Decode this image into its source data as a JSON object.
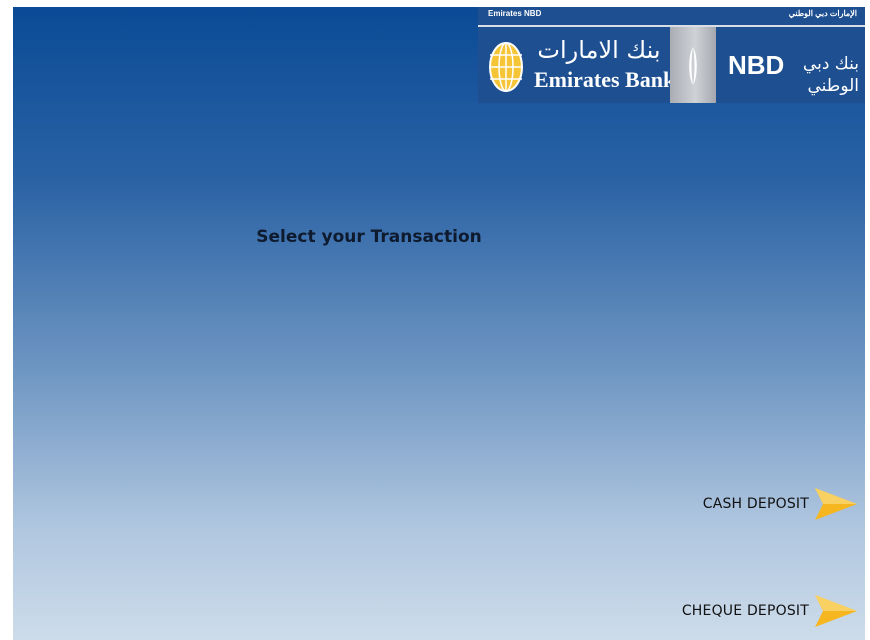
{
  "logo": {
    "top_left_text": "Emirates NBD",
    "top_right_text": "الإمارات دبي الوطني",
    "emirates_bank_arabic": "بنك الامارات",
    "emirates_bank_english": "Emirates Bank",
    "nbd_text": "NBD",
    "nbd_arabic": "بنك دبي الوطني"
  },
  "screen": {
    "title": "Select your Transaction"
  },
  "options": [
    {
      "label": "CASH DEPOSIT"
    },
    {
      "label": "CHEQUE DEPOSIT"
    }
  ],
  "colors": {
    "gradient_top": "#0a4a96",
    "gradient_bottom": "#cddcea",
    "logo_background": "#1d4f91",
    "arrow": "#f5b61f"
  },
  "icons": {
    "globe": "globe-logo-icon",
    "nbd": "nbd-logo-mark-icon",
    "arrow": "arrow-right-icon"
  }
}
